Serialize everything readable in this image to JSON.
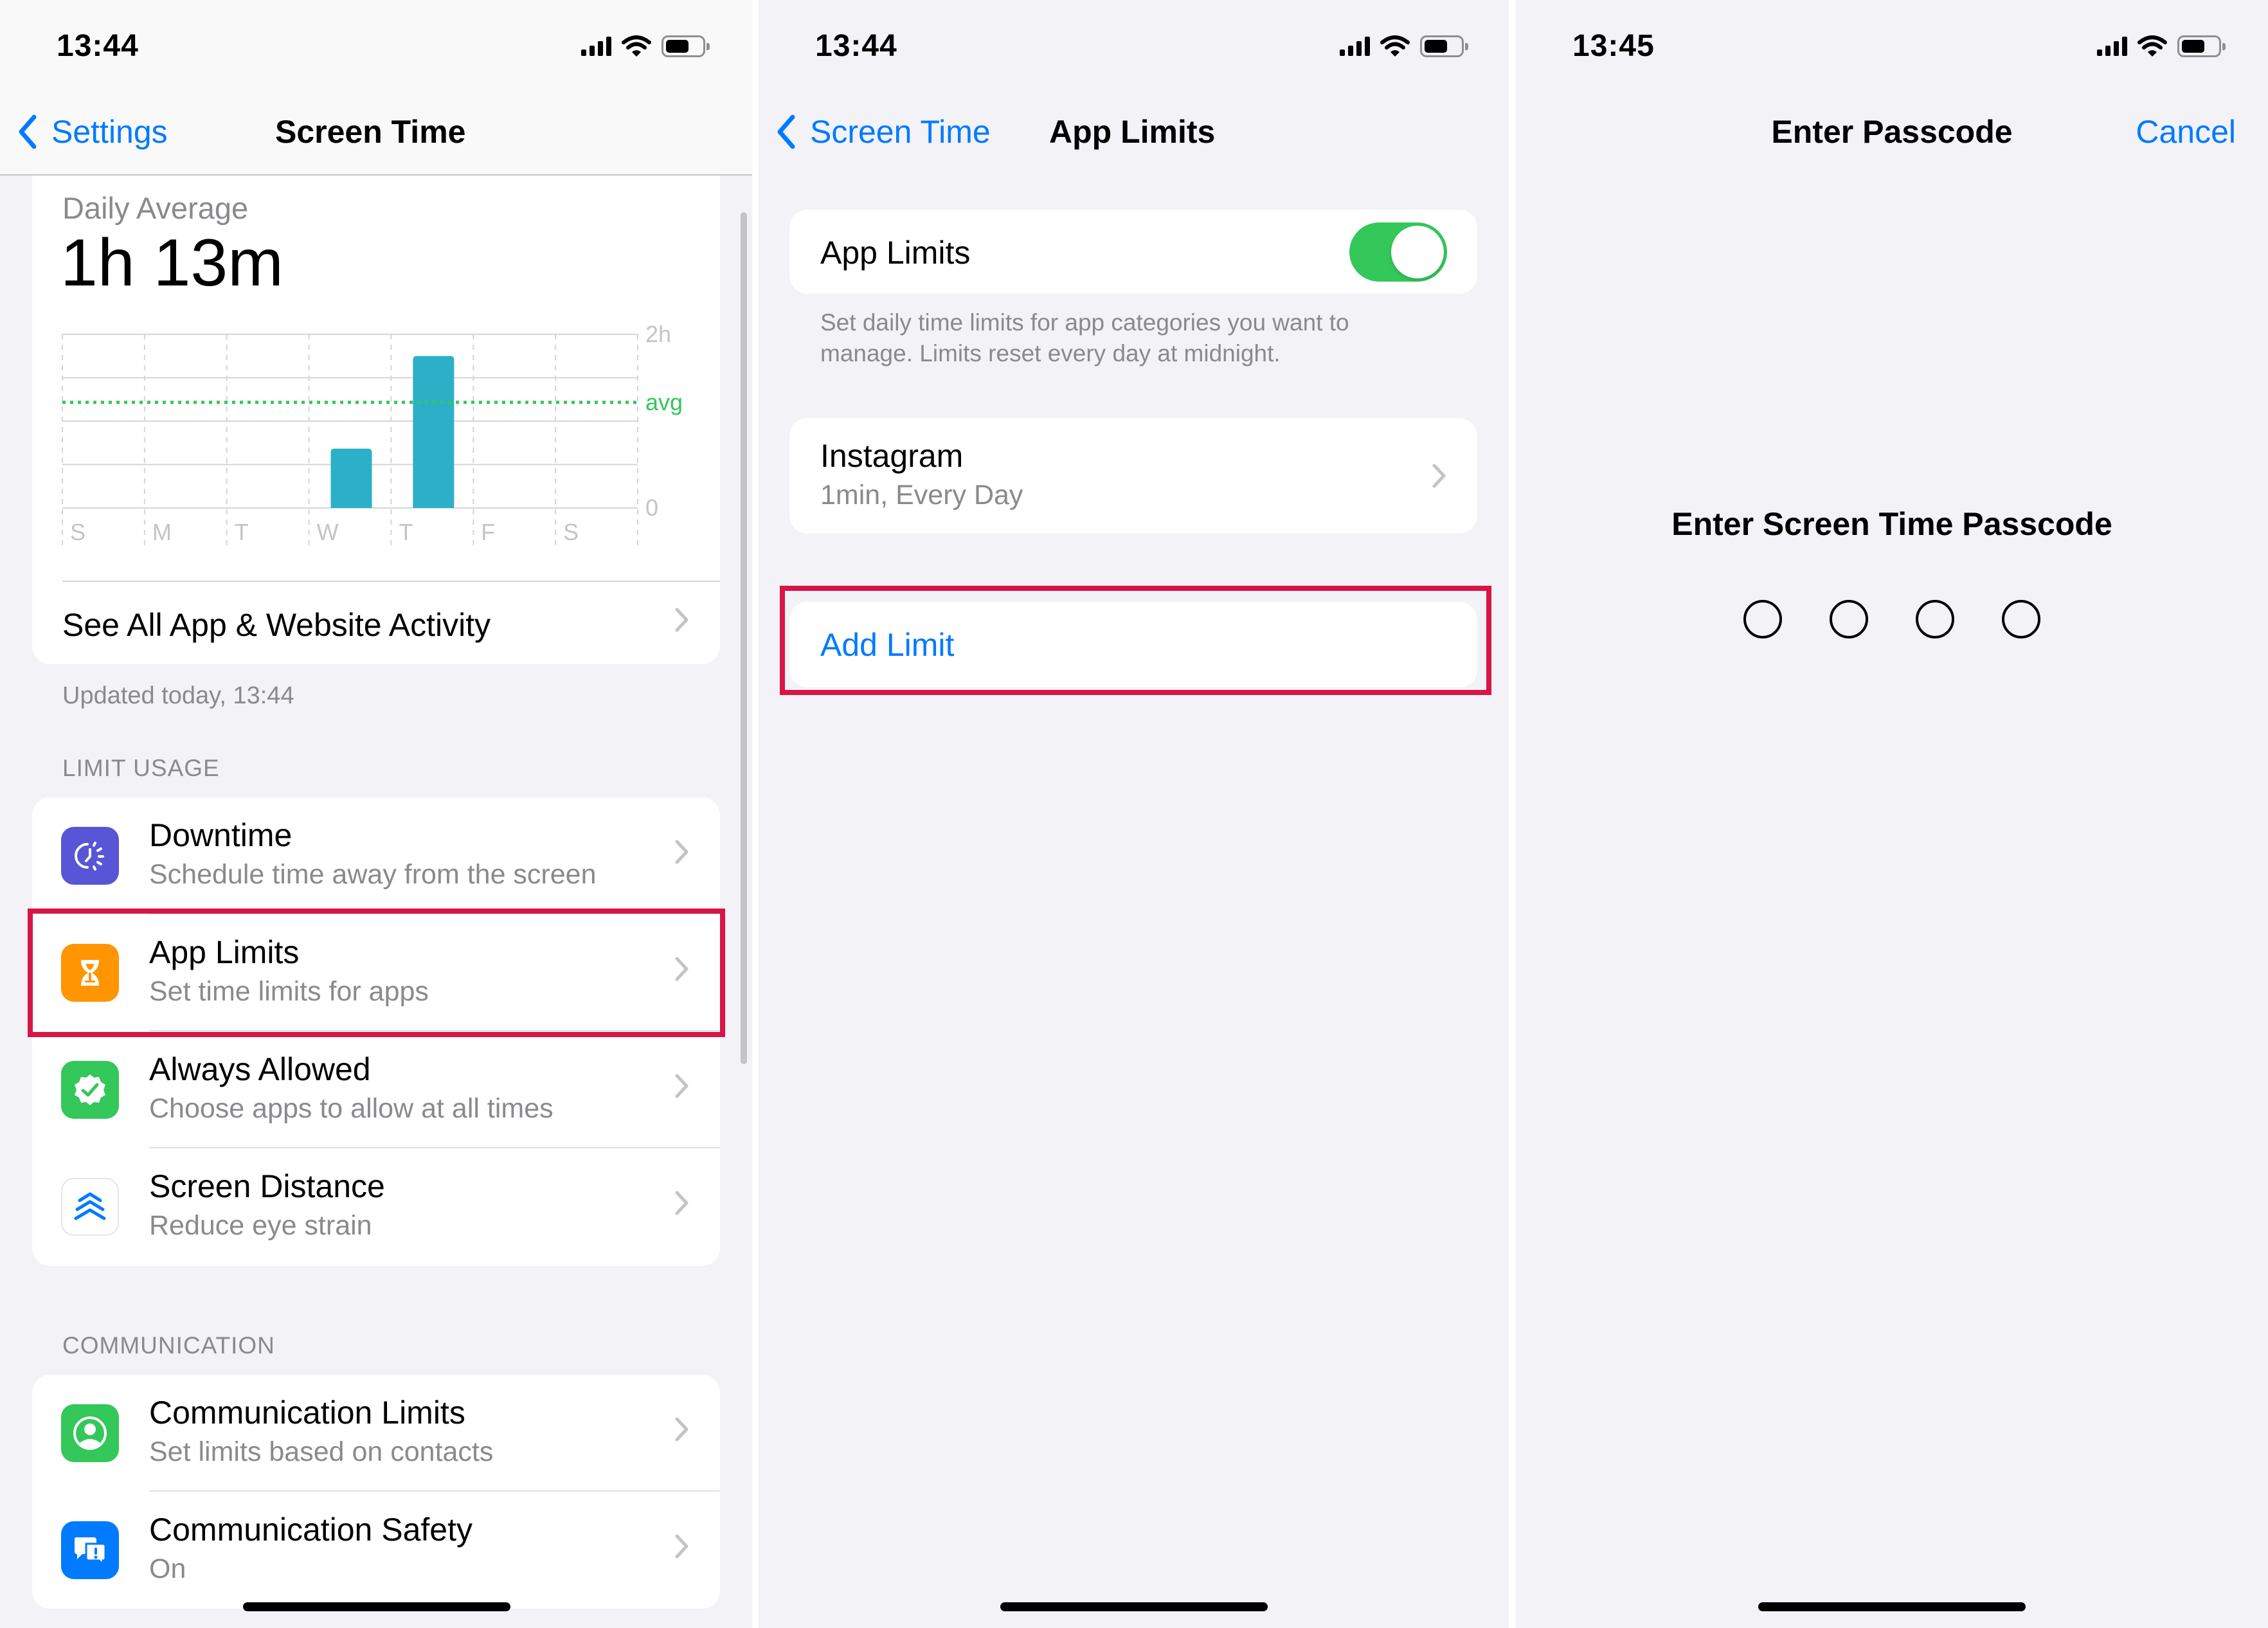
{
  "screens": [
    {
      "status_time": "13:44",
      "battery_level": 0.65,
      "nav": {
        "back_label": "Settings",
        "title": "Screen Time"
      },
      "daily_average": {
        "label": "Daily Average",
        "value": "1h 13m"
      },
      "see_all_label": "See All App & Website Activity",
      "updated_text": "Updated today, 13:44",
      "limit_usage_header": "LIMIT USAGE",
      "limit_usage_items": [
        {
          "title": "Downtime",
          "subtitle": "Schedule time away from the screen",
          "icon": "downtime-icon",
          "color": "#5856d6"
        },
        {
          "title": "App Limits",
          "subtitle": "Set time limits for apps",
          "icon": "hourglass-icon",
          "color": "#ff9500",
          "highlighted": true
        },
        {
          "title": "Always Allowed",
          "subtitle": "Choose apps to allow at all times",
          "icon": "checkmark-seal-icon",
          "color": "#34c759"
        },
        {
          "title": "Screen Distance",
          "subtitle": "Reduce eye strain",
          "icon": "chevrons-up-icon",
          "color": "#ffffff"
        }
      ],
      "communication_header": "COMMUNICATION",
      "communication_items": [
        {
          "title": "Communication Limits",
          "subtitle": "Set limits based on contacts",
          "icon": "person-circle-icon",
          "color": "#34c759"
        },
        {
          "title": "Communication Safety",
          "subtitle": "On",
          "icon": "chat-bubbles-alert-icon",
          "color": "#007aff"
        }
      ]
    },
    {
      "status_time": "13:44",
      "battery_level": 0.65,
      "nav": {
        "back_label": "Screen Time",
        "title": "App Limits"
      },
      "toggle": {
        "label": "App Limits",
        "on": true
      },
      "footer_line1": "Set daily time limits for app categories you want to",
      "footer_line2": "manage. Limits reset every day at midnight.",
      "limits": [
        {
          "app": "Instagram",
          "detail": "1min, Every Day"
        }
      ],
      "add_limit_label": "Add Limit"
    },
    {
      "status_time": "13:45",
      "battery_level": 0.65,
      "nav": {
        "title": "Enter Passcode",
        "cancel_label": "Cancel"
      },
      "prompt": "Enter Screen Time Passcode",
      "passcode_digits": 4,
      "digits_entered": 0
    }
  ],
  "chart_data": {
    "type": "bar",
    "title": "Daily Average",
    "categories": [
      "S",
      "M",
      "T",
      "W",
      "T",
      "F",
      "S"
    ],
    "values": [
      0,
      0,
      0,
      41,
      105,
      0,
      0
    ],
    "unit": "minutes",
    "ylim": [
      0,
      120
    ],
    "ytick_labels": [
      "0",
      "2h"
    ],
    "average": 73,
    "average_label": "avg",
    "bar_color": "#2bb0c8",
    "average_color": "#34c759",
    "grid": true
  },
  "colors": {
    "accent": "#007aff",
    "highlight_border": "#d81546",
    "background": "#f2f2f7"
  }
}
